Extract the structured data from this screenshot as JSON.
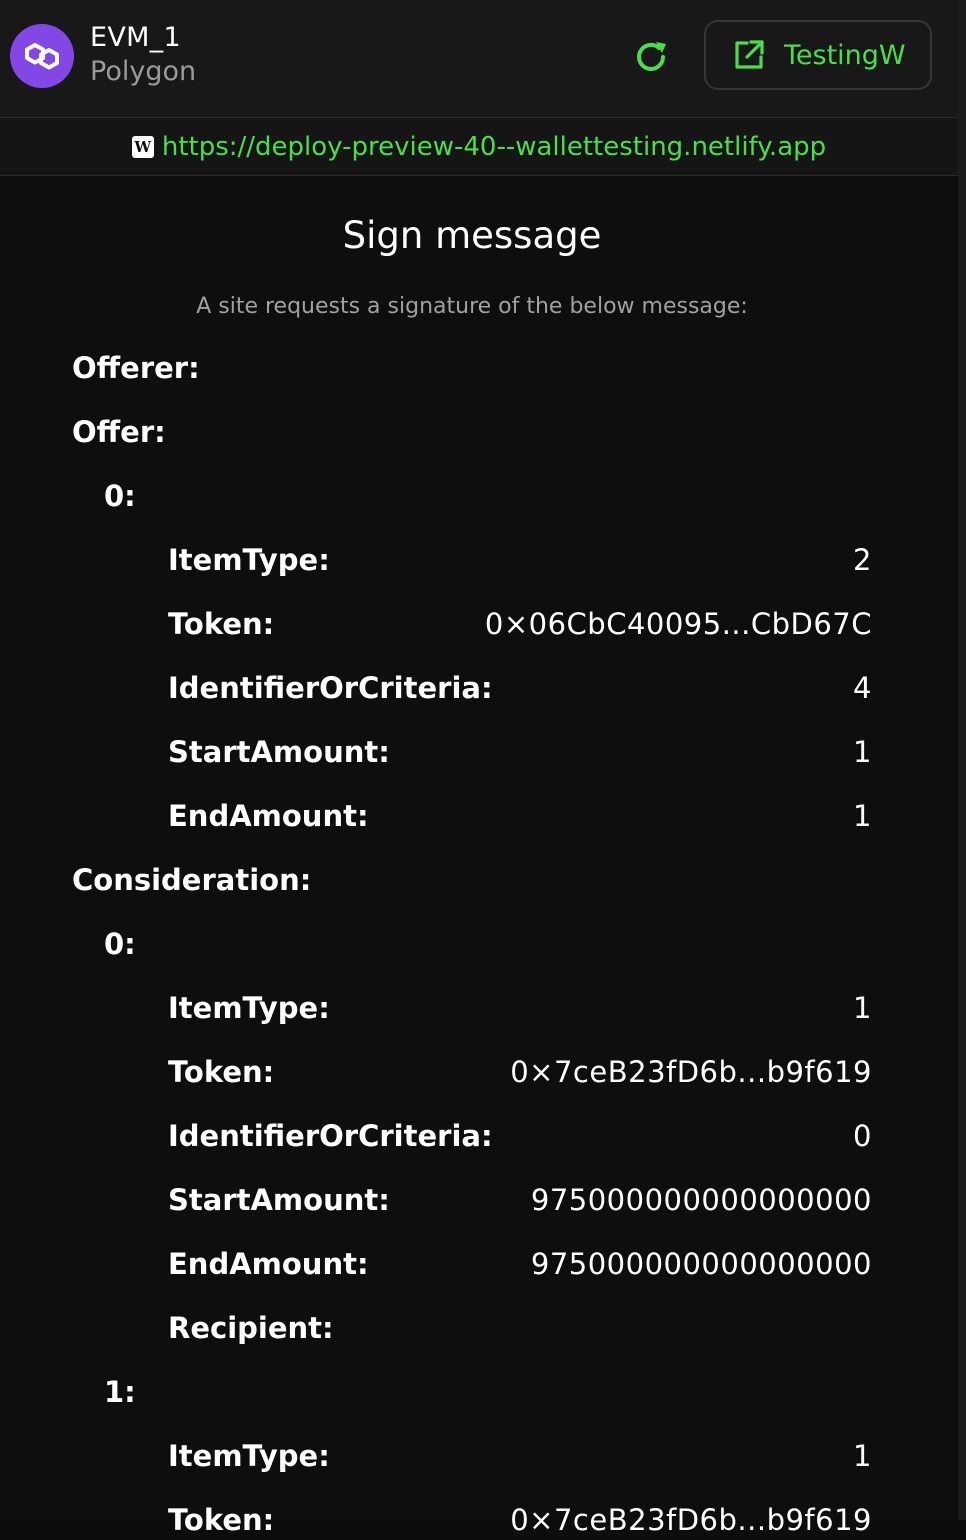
{
  "header": {
    "account_name": "EVM_1",
    "network_name": "Polygon",
    "wallet_label": "TestingW",
    "accent_color": "#4ade4a",
    "network_color": "#8247e5",
    "icons": {
      "network": "polygon-logo",
      "refresh": "refresh-icon",
      "wallet": "external-link-icon"
    }
  },
  "site": {
    "favicon_letter": "W",
    "url": "https://deploy-preview-40--wallettesting.netlify.app"
  },
  "request": {
    "title": "Sign message",
    "subtitle": "A site requests a signature of the below message:"
  },
  "message": {
    "offerer_label": "Offerer:",
    "offer_label": "Offer:",
    "offer": [
      {
        "index_label": "0:",
        "fields": [
          {
            "key": "ItemType:",
            "value": "2"
          },
          {
            "key": "Token:",
            "value": "0×06CbC40095...CbD67C"
          },
          {
            "key": "IdentifierOrCriteria:",
            "value": "4"
          },
          {
            "key": "StartAmount:",
            "value": "1"
          },
          {
            "key": "EndAmount:",
            "value": "1"
          }
        ]
      }
    ],
    "consideration_label": "Consideration:",
    "consideration": [
      {
        "index_label": "0:",
        "fields": [
          {
            "key": "ItemType:",
            "value": "1"
          },
          {
            "key": "Token:",
            "value": "0×7ceB23fD6b...b9f619"
          },
          {
            "key": "IdentifierOrCriteria:",
            "value": "0"
          },
          {
            "key": "StartAmount:",
            "value": "975000000000000000"
          },
          {
            "key": "EndAmount:",
            "value": "975000000000000000"
          },
          {
            "key": "Recipient:",
            "value": ""
          }
        ]
      },
      {
        "index_label": "1:",
        "fields": [
          {
            "key": "ItemType:",
            "value": "1"
          },
          {
            "key": "Token:",
            "value": "0×7ceB23fD6b...b9f619"
          }
        ]
      }
    ]
  }
}
